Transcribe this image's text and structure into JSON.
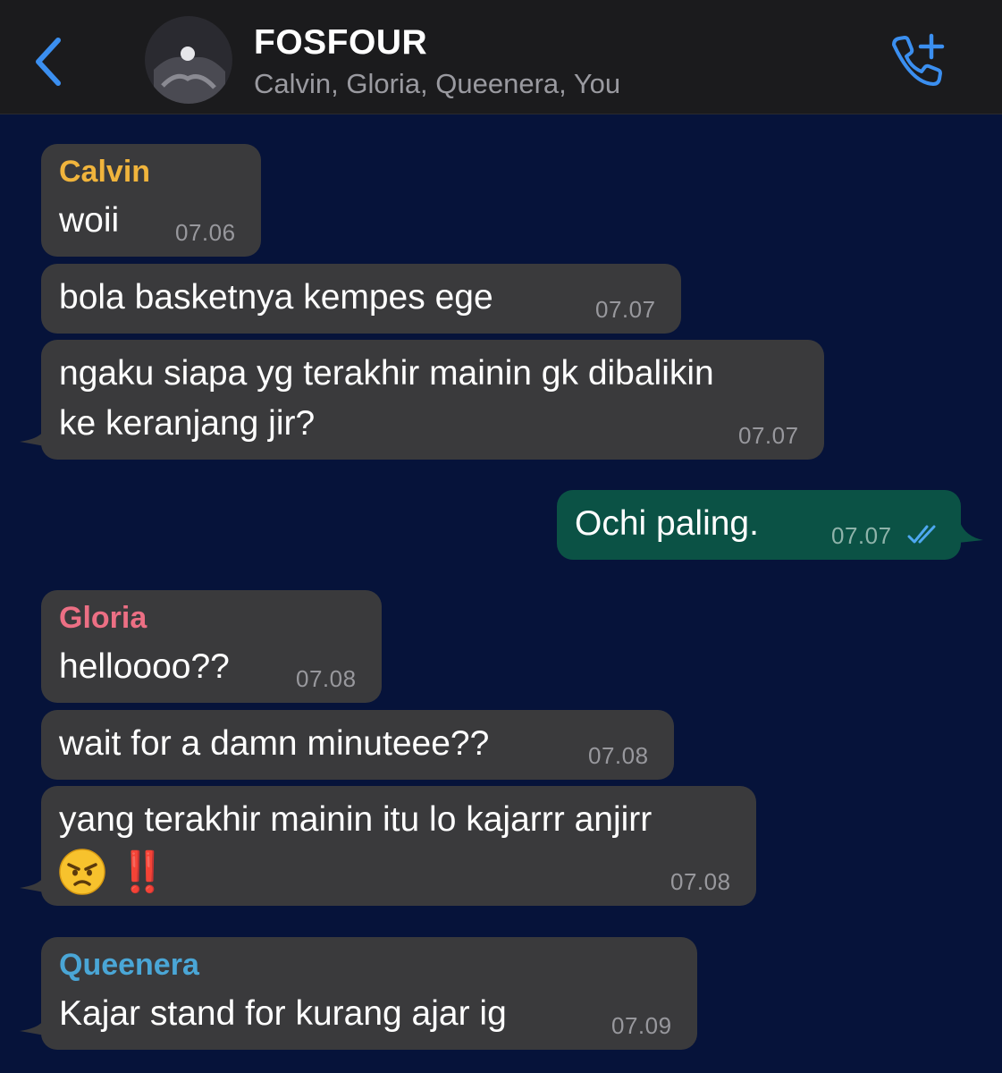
{
  "header": {
    "group_name": "FOSFOUR",
    "members": "Calvin, Gloria, Queenera, You",
    "back_icon": "chevron-left-icon",
    "call_icon": "phone-plus-icon",
    "accent_color": "#3b8ff0"
  },
  "messages": [
    {
      "sender": "Calvin",
      "sender_color": "#f0b43c",
      "text": "woii",
      "time": "07.06"
    },
    {
      "text": "bola basketnya kempes ege",
      "time": "07.07"
    },
    {
      "text_line1": "ngaku siapa yg terakhir mainin gk dibalikin",
      "text_line2": "ke keranjang jir?",
      "time": "07.07"
    },
    {
      "text": "Ochi paling.",
      "time": "07.07",
      "status_icon": "double-check-icon"
    },
    {
      "sender": "Gloria",
      "sender_color": "#ec6f84",
      "text": "helloooo??",
      "time": "07.08"
    },
    {
      "text": "wait for a damn minuteee??",
      "time": "07.08"
    },
    {
      "text_line1": "yang terakhir mainin itu lo kajarrr anjirr",
      "emoji": "angry-face-icon",
      "text_line2_suffix": "‼️",
      "time": "07.08"
    },
    {
      "sender": "Queenera",
      "sender_color": "#4aa6d6",
      "text": "Kajar stand for kurang ajar ig",
      "time": "07.09"
    }
  ]
}
